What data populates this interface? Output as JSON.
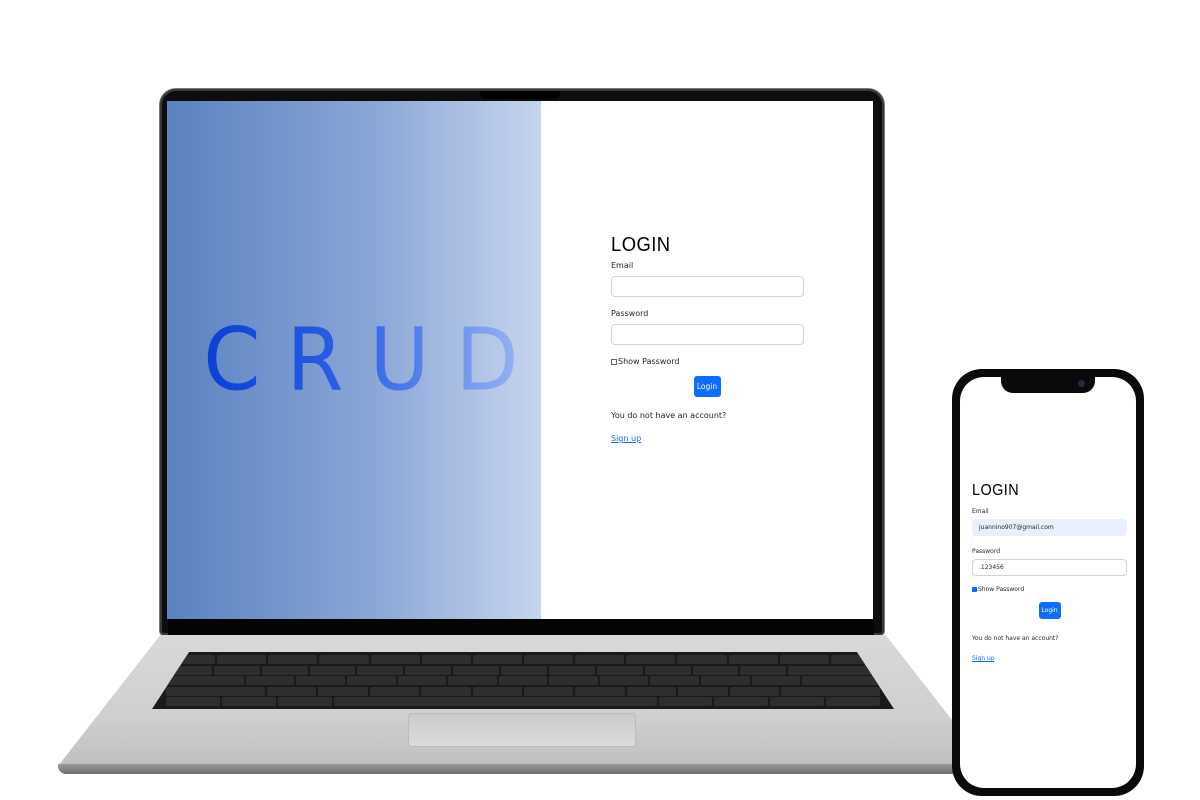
{
  "laptop": {
    "hero_text": "CRUD",
    "login": {
      "title": "LOGIN",
      "email_label": "Email",
      "email_value": "",
      "password_label": "Password",
      "password_value": "",
      "show_password_label": "Show Password",
      "show_password_checked": false,
      "login_button": "Login",
      "question": "You do not have an account?",
      "signup_link": "Sign up"
    }
  },
  "phone": {
    "login": {
      "title": "LOGIN",
      "email_label": "Email",
      "email_value": "juannino907@gmail.com",
      "password_label": "Password",
      "password_value": ".123456",
      "show_password_label": "Show Password",
      "show_password_checked": true,
      "login_button": "Login",
      "question": "You do not have an account?",
      "signup_link": "Sign up"
    }
  },
  "colors": {
    "primary": "#0d6efd",
    "hero_gradient_start": "#5a82c0",
    "hero_gradient_end": "#c7d5ee",
    "hero_text": "#0b3fd6",
    "autofill_bg": "#e8f0fe"
  }
}
